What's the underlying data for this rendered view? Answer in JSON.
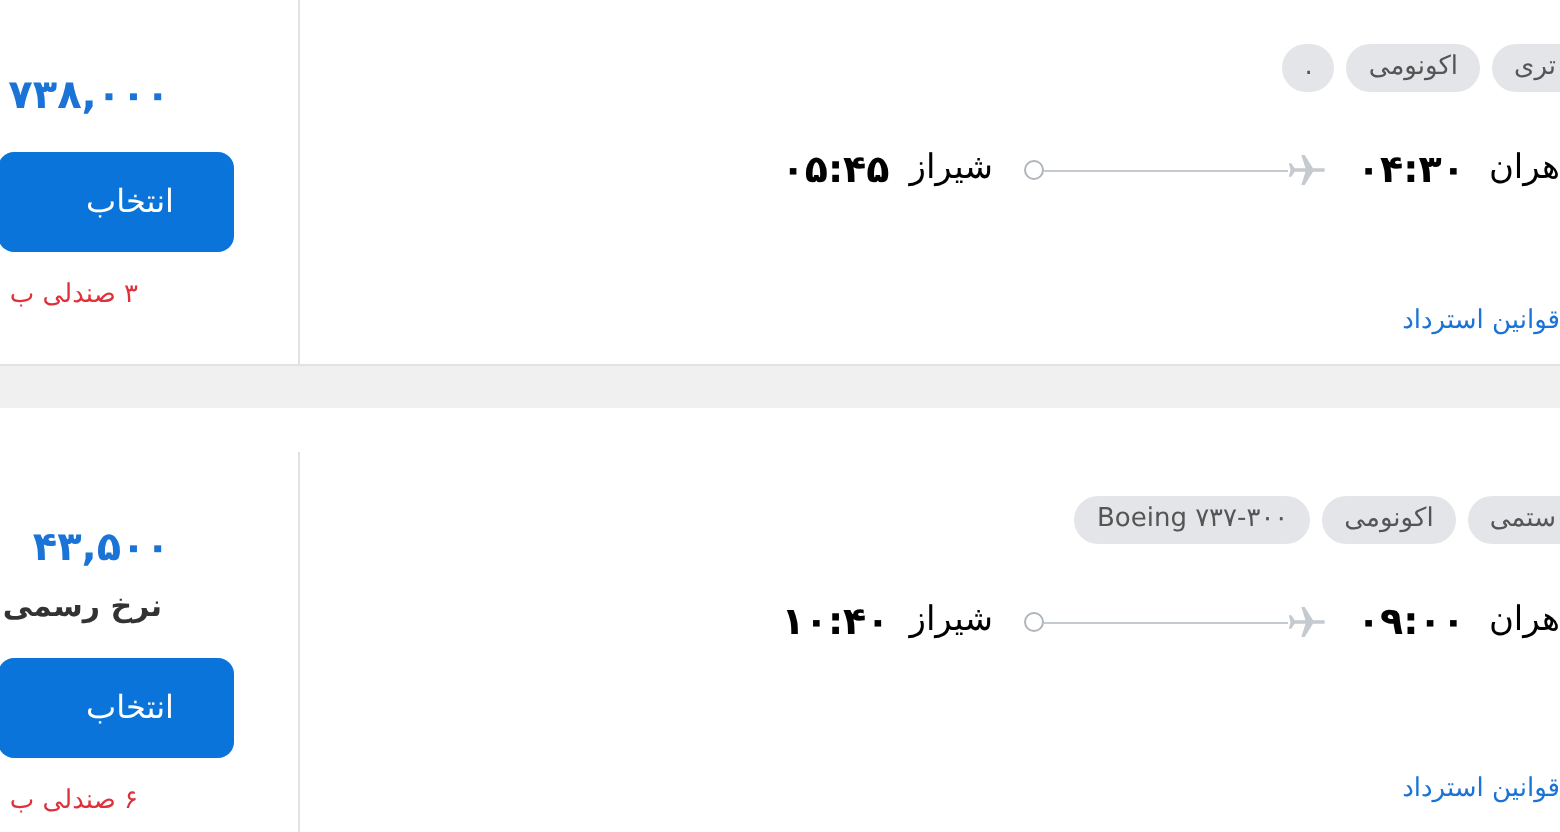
{
  "flights": [
    {
      "tags": [
        "تری",
        "اکونومی",
        "."
      ],
      "origin": "هران",
      "departure": "۰۴:۳۰",
      "destination": "شیراز",
      "arrival": "۰۵:۴۵",
      "refund_link": "قوانین استرداد",
      "price": "۷۳۸,۰۰۰",
      "select_button": "انتخاب",
      "seats": "۳ صندلی ب"
    },
    {
      "tags": [
        "ستمی",
        "اکونومی",
        "Boeing ۷۳۷-۳۰۰"
      ],
      "origin": "هران",
      "departure": "۰۹:۰۰",
      "destination": "شیراز",
      "arrival": "۱۰:۴۰",
      "refund_link": "قوانین استرداد",
      "price": "۴۳,۵۰۰",
      "fare_note": "نرخ رسمی",
      "select_button": "انتخاب",
      "seats": "۶ صندلی ب"
    }
  ]
}
